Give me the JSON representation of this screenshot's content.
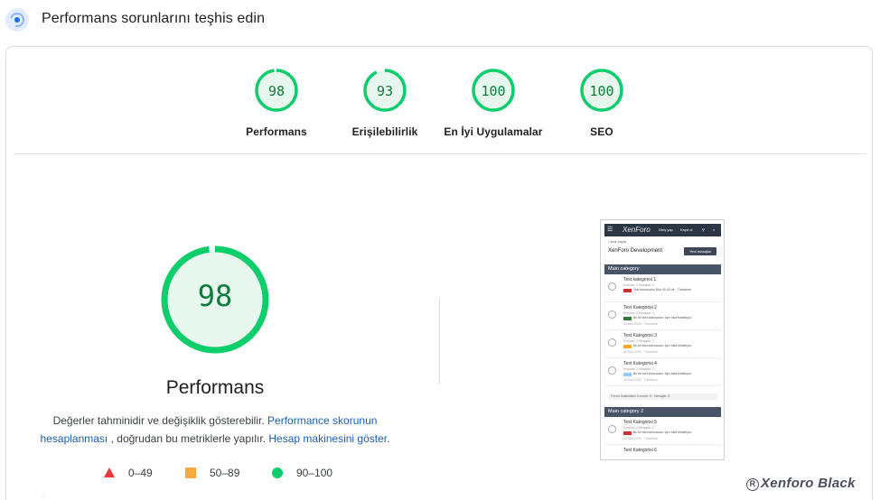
{
  "header": {
    "title": "Performans sorunlarını teşhis edin",
    "icon": "lighthouse-gauge-icon"
  },
  "gauges": [
    {
      "score": "98",
      "value": 98,
      "label": "Performans"
    },
    {
      "score": "93",
      "value": 93,
      "label": "Erişilebilirlik"
    },
    {
      "score": "100",
      "value": 100,
      "label": "En İyi Uygulamalar"
    },
    {
      "score": "100",
      "value": 100,
      "label": "SEO"
    }
  ],
  "main": {
    "score": "98",
    "value": 98,
    "title": "Performans",
    "desc_part1": "Değerler tahminidir ve değişiklik gösterebilir.",
    "link1": "Performance skorunun hesaplanması",
    "desc_part2": ", doğrudan bu metriklerle yapılır.",
    "link2": "Hesap makinesini göster",
    "desc_end": "."
  },
  "legend": [
    {
      "shape": "triangle",
      "range": "0–49",
      "color": "#e8383b"
    },
    {
      "shape": "square",
      "range": "50–89",
      "color": "#f7a93b"
    },
    {
      "shape": "circle",
      "range": "90–100",
      "color": "#0cce6b"
    }
  ],
  "colors": {
    "pass": "#0cce6b",
    "pass_text": "#0c7d3a",
    "pass_bg": "#e8f7ee",
    "link": "#1a5fb4"
  },
  "thumbnail": {
    "logo": "XenForo",
    "login": "Giriş yap",
    "register": "Kayıt ol",
    "breadcrumb": "‹ Ana sayfa",
    "forum_title": "XenForo Development",
    "new_post": "Yeni mesajlar",
    "categories": [
      {
        "label": "Main category"
      },
      {
        "label": "Main category 2"
      }
    ],
    "rows": [
      {
        "title": "Test kategorisi 1",
        "meta": "Konular: 3  Mesajlar: 5",
        "prefix_color": "#d32f2f",
        "post": "Test konusudur  Dün 00:40 de · Tritoninen",
        "date": ""
      },
      {
        "title": "Test Kategorisi 2",
        "meta": "Konular: 3  Mesajlar: 4",
        "prefix_color": "#2e7d32",
        "post": "Bu bir test konusudur. Ayrı tıkla tıklatılıyor.",
        "date": "30 Mar 2025 · Tritoninen"
      },
      {
        "title": "Test Kategorisi 3",
        "meta": "Konular: 1  Mesajlar: 1",
        "prefix_color": "#f9a825",
        "post": "Bu bir test konusudur. Ayrı tıkla tıklatılıyor.",
        "date": "30 Mar 2025 · Tritoninen"
      },
      {
        "title": "Test Kategorisi 4",
        "meta": "Konular: 1  Mesajlar: 2",
        "prefix_color": "#90caf9",
        "post": "Bu bir test konusudur. Ayrı tıkla tıklatılıyor.",
        "date": "30 Mar 2025 · Tritoninen"
      },
      {
        "title": "Test Kategorisi 5",
        "meta": "Konular: 3  Mesajlar: 5",
        "prefix_color": "#d32f2f",
        "post": "Bu bir test konusudur. Ayrı tıkla tıklatılıyor.",
        "date": "30 Mar 2025 · Tritoninen"
      }
    ],
    "stats": "Forum istatistikleri  Konular: 8 · Mesajlar: 8",
    "last_row": "Test Kategorisi 6"
  },
  "watermark": {
    "mark": "R",
    "text": "Xenforo Black"
  },
  "bottom_mark": "·"
}
